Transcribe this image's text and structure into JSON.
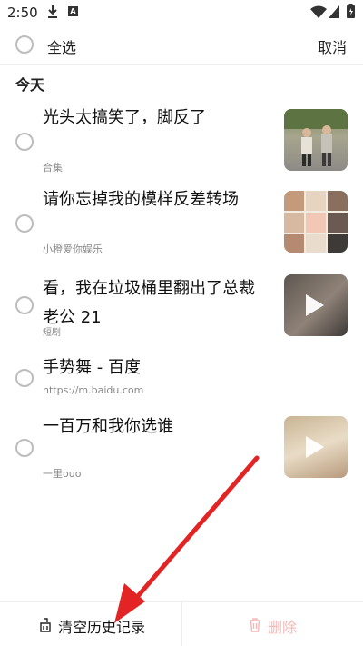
{
  "status_bar": {
    "time": "2:50",
    "a_badge": "A"
  },
  "header": {
    "select_all": "全选",
    "cancel": "取消"
  },
  "section": {
    "title": "今天"
  },
  "items": [
    {
      "title_lines": [
        "光头太搞笑了，脚反了"
      ],
      "subtitle": "合集",
      "has_thumb": true
    },
    {
      "title_lines": [
        "请你忘掉我的模样反差转场"
      ],
      "subtitle": "小橙爱你娱乐",
      "has_thumb": true
    },
    {
      "title_lines": [
        "看，我在垃圾桶里翻出了总裁",
        "老公 21"
      ],
      "subtitle": "短剧",
      "has_thumb": true
    },
    {
      "title_lines": [
        "手势舞 - 百度"
      ],
      "subtitle": "https://m.baidu.com",
      "has_thumb": false
    },
    {
      "title_lines": [
        "一百万和我你选谁"
      ],
      "subtitle": "一里ouo",
      "has_thumb": true
    }
  ],
  "bottom": {
    "clear_history": "清空历史记录",
    "delete": "删除"
  },
  "colors": {
    "accent_red": "#e8312b",
    "delete_disabled": "#f4b8b8",
    "annotation_arrow": "#e32424"
  }
}
